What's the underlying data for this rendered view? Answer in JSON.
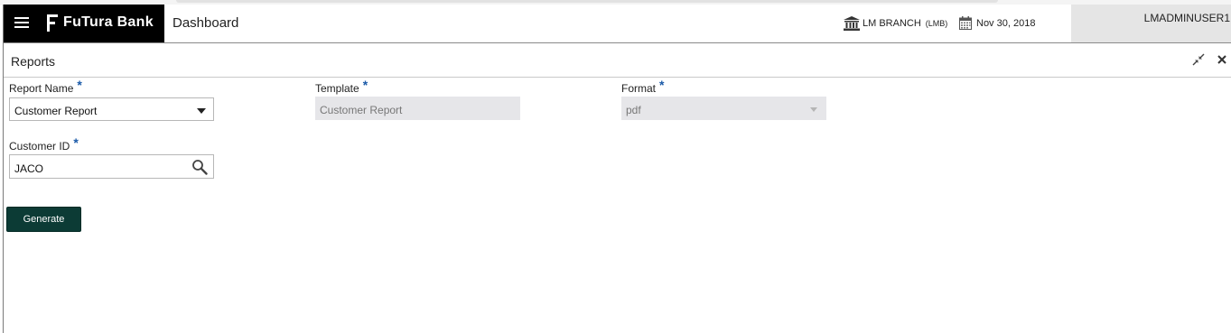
{
  "app": {
    "brand": "FuTura Bank",
    "page_title": "Dashboard",
    "branch_name": "LM BRANCH",
    "branch_code": "(LMB)",
    "date": "Nov 30, 2018",
    "user": "LMADMINUSER1"
  },
  "panel": {
    "title": "Reports"
  },
  "form": {
    "report_name": {
      "label": "Report Name",
      "required_mark": "*",
      "value": "Customer Report"
    },
    "template": {
      "label": "Template",
      "required_mark": "*",
      "value": "Customer Report"
    },
    "format": {
      "label": "Format",
      "required_mark": "*",
      "value": "pdf"
    },
    "customer_id": {
      "label": "Customer ID",
      "required_mark": "*",
      "value": "JACO"
    },
    "generate_label": "Generate"
  },
  "icons": {
    "menu": "hamburger-menu-icon",
    "logo": "futura-logo-icon",
    "branch": "bank-building-icon",
    "date": "calendar-icon",
    "minimize": "collapse-arrows-icon",
    "close": "close-icon",
    "dropdown": "caret-down-icon",
    "search": "search-icon"
  },
  "colors": {
    "header_brand_bg": "#000000",
    "user_block_bg": "#e5e5e5",
    "required_mark": "#1a5aa8",
    "readonly_bg": "#e6e6e9",
    "primary_button": "#0c3b35"
  }
}
